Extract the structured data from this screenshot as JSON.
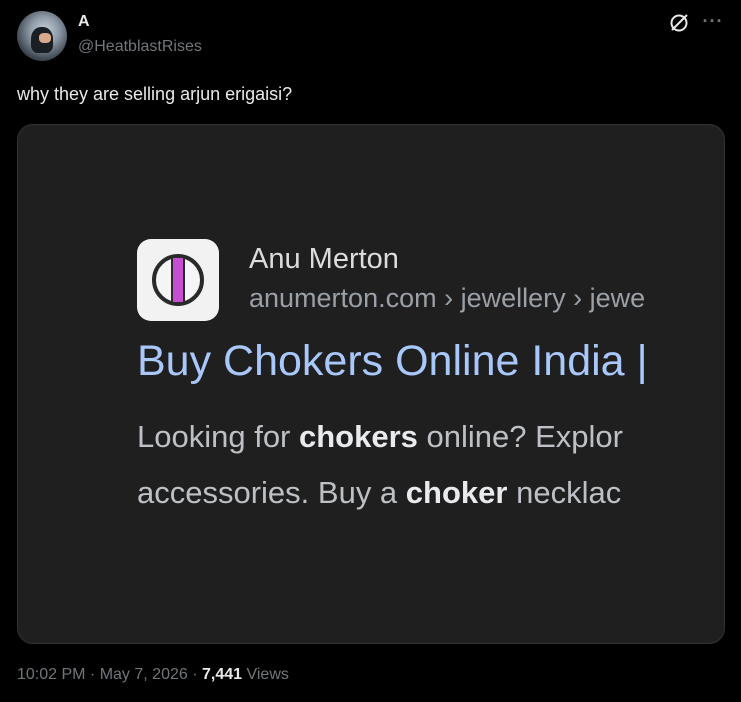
{
  "author": {
    "display_name": "A",
    "handle": "@HeatblastRises"
  },
  "icons": {
    "avatar": "avatar",
    "grok": "grok-icon",
    "more": "more-icon"
  },
  "tweet": {
    "text": "why they are selling arjun erigaisi?"
  },
  "media": {
    "site_name": "Anu Merton",
    "site_url": "anumerton.com › jewellery › jewe",
    "result_title": "Buy Chokers Online India | ",
    "snippet_line1": {
      "pre": "Looking for ",
      "bold": "chokers",
      "post": " online? Explor"
    },
    "snippet_line2": {
      "pre": "accessories. Buy a ",
      "bold": "choker",
      "post": " necklac"
    }
  },
  "meta": {
    "time": "10:02 PM",
    "sep1": " · ",
    "date": "May 7, 2026",
    "sep2": " · ",
    "views_count": "7,441",
    "views_label": " Views"
  },
  "colors": {
    "background": "#000000",
    "link_title": "#a8c7fa",
    "muted": "#71767b"
  }
}
